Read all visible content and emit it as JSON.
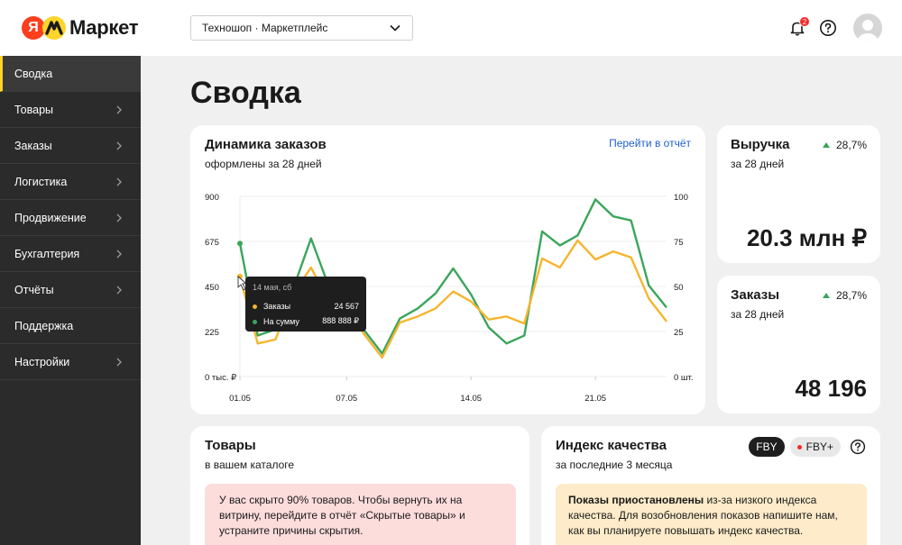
{
  "logo": {
    "ya_letter": "Я",
    "text": "Маркет"
  },
  "header": {
    "store_selector": "Техношоп · Маркетплейс",
    "notification_count": "2"
  },
  "sidebar": {
    "items": [
      {
        "label": "Сводка",
        "active": true,
        "has_arrow": false
      },
      {
        "label": "Товары",
        "active": false,
        "has_arrow": true
      },
      {
        "label": "Заказы",
        "active": false,
        "has_arrow": true
      },
      {
        "label": "Логистика",
        "active": false,
        "has_arrow": true
      },
      {
        "label": "Продвижение",
        "active": false,
        "has_arrow": true
      },
      {
        "label": "Бухгалтерия",
        "active": false,
        "has_arrow": true
      },
      {
        "label": "Отчёты",
        "active": false,
        "has_arrow": true
      },
      {
        "label": "Поддержка",
        "active": false,
        "has_arrow": false
      },
      {
        "label": "Настройки",
        "active": false,
        "has_arrow": true
      }
    ]
  },
  "page": {
    "title": "Сводка"
  },
  "orders_dynamics": {
    "title": "Динамика заказов",
    "subtitle": "оформлены за 28 дней",
    "report_link": "Перейти в отчёт",
    "tooltip": {
      "date": "14 мая, сб",
      "rows": [
        {
          "label": "Заказы",
          "value": "24 567",
          "color": "#f5b52f"
        },
        {
          "label": "На сумму",
          "value": "888 888 ₽",
          "color": "#3ba55c"
        }
      ]
    }
  },
  "chart_data": {
    "type": "line",
    "left_axis": {
      "ticks": [
        "0 тыс. ₽",
        "225",
        "450",
        "675",
        "900"
      ],
      "ylim": [
        0,
        900
      ]
    },
    "right_axis": {
      "ticks": [
        "0 шт.",
        "25",
        "50",
        "75",
        "100"
      ],
      "ylim": [
        0,
        100
      ]
    },
    "x_ticks": [
      "01.05",
      "07.05",
      "14.05",
      "21.05"
    ],
    "x": [
      1,
      2,
      3,
      4,
      5,
      6,
      7,
      8,
      9,
      10,
      11,
      12,
      13,
      14,
      15,
      16,
      17,
      18,
      19,
      20,
      21,
      22,
      23,
      24
    ],
    "series": [
      {
        "name": "На сумму",
        "color": "#3ba55c",
        "axis": "left",
        "values": [
          665,
          205,
          235,
          440,
          690,
          450,
          410,
          230,
          115,
          290,
          340,
          415,
          540,
          410,
          245,
          165,
          205,
          725,
          655,
          705,
          885,
          800,
          780,
          455,
          345
        ]
      },
      {
        "name": "Заказы",
        "color": "#f5b52f",
        "axis": "left",
        "values": [
          500,
          165,
          185,
          415,
          545,
          375,
          350,
          210,
          95,
          270,
          300,
          340,
          425,
          375,
          285,
          300,
          265,
          590,
          545,
          680,
          585,
          625,
          595,
          390,
          275
        ]
      }
    ]
  },
  "revenue": {
    "title": "Выручка",
    "subtitle": "за 28 дней",
    "delta": "28,7%",
    "value": "20.3 млн ₽"
  },
  "orders": {
    "title": "Заказы",
    "subtitle": "за 28 дней",
    "delta": "28,7%",
    "value": "48 196"
  },
  "goods": {
    "title": "Товары",
    "subtitle": "в вашем каталоге",
    "notice": "У вас скрыто 90% товаров. Чтобы вернуть их на витрину, перейдите в отчёт «Скрытые товары» и устраните причины скрытия."
  },
  "quality": {
    "title": "Индекс качества",
    "subtitle": "за последние 3 месяца",
    "chip_fby": "FBY",
    "chip_fby_plus": "FBY+",
    "notice_bold": "Показы приостановлены",
    "notice_rest": " из-за низкого индекса качества. Для возобновления показов напишите нам, как вы планируете повышать индекс качества."
  }
}
